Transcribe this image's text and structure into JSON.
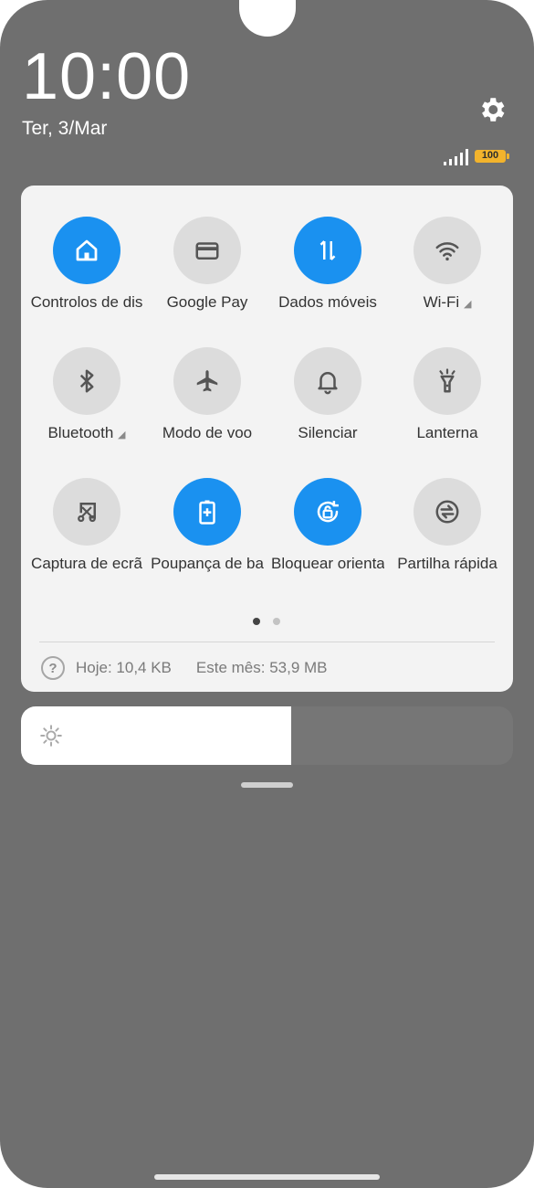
{
  "status": {
    "time": "10:00",
    "date": "Ter, 3/Mar",
    "battery": "100",
    "signal_bars": 5
  },
  "colors": {
    "accent": "#1a91f0",
    "tile_off": "#dcdcdc",
    "panel": "#f3f3f3",
    "shade": "#6f6f6f"
  },
  "tiles": [
    {
      "label": "Controlos de dis",
      "icon": "home-icon",
      "active": true
    },
    {
      "label": "Google Pay",
      "icon": "card-icon",
      "active": false
    },
    {
      "label": "Dados móveis",
      "icon": "data-arrows-icon",
      "active": true
    },
    {
      "label": "Wi-Fi",
      "icon": "wifi-icon",
      "active": false,
      "expandable": true
    },
    {
      "label": "Bluetooth",
      "icon": "bluetooth-icon",
      "active": false,
      "expandable": true
    },
    {
      "label": "Modo de voo",
      "icon": "airplane-icon",
      "active": false
    },
    {
      "label": "Silenciar",
      "icon": "bell-icon",
      "active": false
    },
    {
      "label": "Lanterna",
      "icon": "flashlight-icon",
      "active": false
    },
    {
      "label": "Captura de ecrã",
      "icon": "screenshot-icon",
      "active": false
    },
    {
      "label": "Poupança de ba",
      "icon": "battery-saver-icon",
      "active": true
    },
    {
      "label": "Bloquear orienta",
      "icon": "rotation-lock-icon",
      "active": true
    },
    {
      "label": "Partilha rápida",
      "icon": "quick-share-icon",
      "active": false
    }
  ],
  "pager": {
    "pages": 2,
    "current": 1
  },
  "usage": {
    "today": "Hoje: 10,4 KB",
    "month": "Este mês: 53,9 MB"
  },
  "brightness": {
    "level": 0.55
  }
}
